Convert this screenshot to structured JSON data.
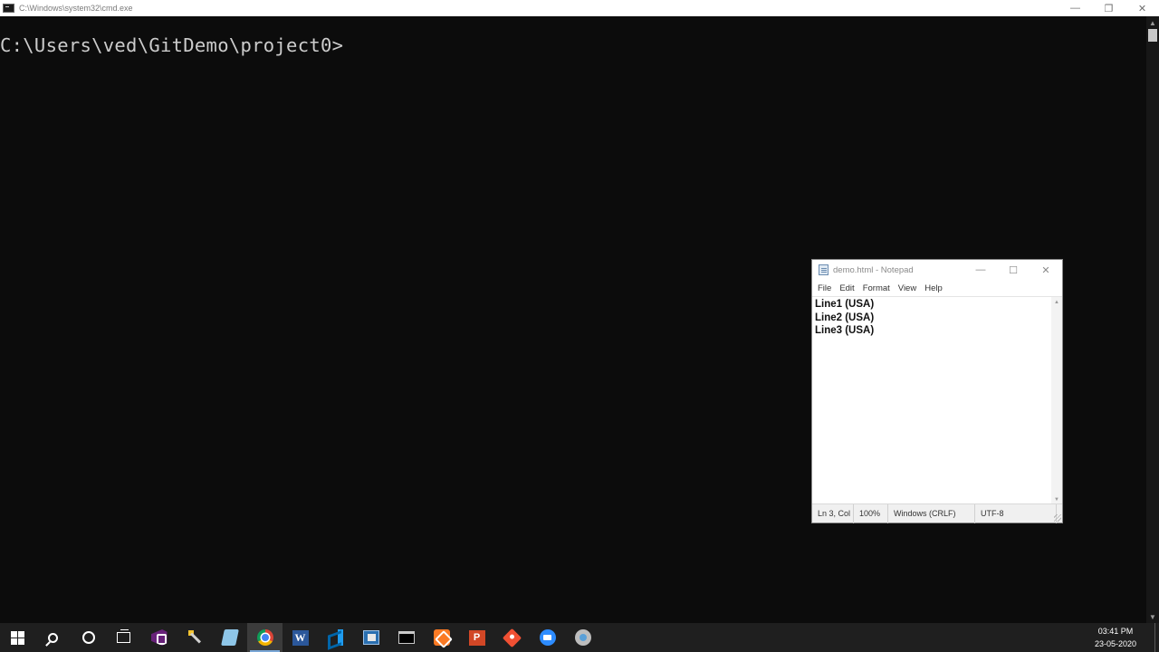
{
  "cmd": {
    "title": "C:\\Windows\\system32\\cmd.exe",
    "prompt": "C:\\Users\\ved\\GitDemo\\project0>",
    "controls": {
      "minimize": "—",
      "restore": "❐",
      "close": "✕"
    }
  },
  "notepad": {
    "title": "demo.html - Notepad",
    "controls": {
      "minimize": "—",
      "maximize": "☐",
      "close": "✕"
    },
    "menu": [
      "File",
      "Edit",
      "Format",
      "View",
      "Help"
    ],
    "lines": [
      "Line1 (USA)",
      "Line2 (USA)",
      "Line3 (USA)"
    ],
    "status": {
      "position": "Ln 3, Col",
      "zoom": "100%",
      "line_ending": "Windows (CRLF)",
      "encoding": "UTF-8"
    }
  },
  "taskbar": {
    "clock": {
      "time": "03:41 PM",
      "date": "23-05-2020"
    },
    "apps": [
      "start-icon",
      "search-icon",
      "cortana-icon",
      "task-view-icon",
      "visual-studio-icon",
      "tools-icon",
      "notepad-plus-plus-icon",
      "chrome-icon",
      "word-icon",
      "vscode-icon",
      "app-icon",
      "cmd-icon",
      "xampp-icon",
      "powerpoint-icon",
      "git-icon",
      "zoom-icon",
      "misc-app-icon"
    ],
    "active_app": "chrome-icon"
  },
  "colors": {
    "console_bg": "#0c0c0c",
    "console_text": "#cccccc",
    "taskbar_bg": "#1f1f1f",
    "accent": "#7aa7d6"
  }
}
